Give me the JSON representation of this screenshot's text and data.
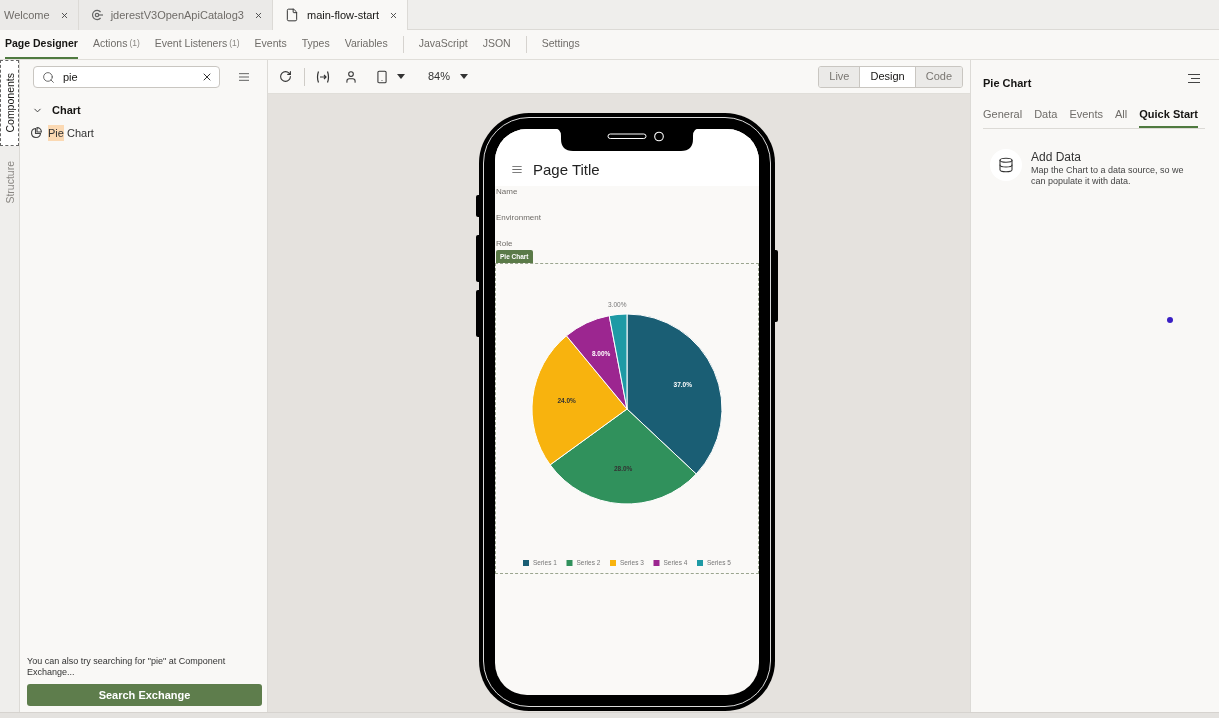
{
  "editor_tabs": [
    {
      "label": "Welcome",
      "kind": "plain",
      "selected": false
    },
    {
      "label": "jderestV3OpenApiCatalog3",
      "kind": "service",
      "selected": false
    },
    {
      "label": "main-flow-start",
      "kind": "page",
      "selected": true
    }
  ],
  "designer_tab_groups": [
    {
      "tabs": [
        {
          "label": "Page Designer",
          "selected": true
        },
        {
          "label": "Actions",
          "count": "(1)",
          "selected": false
        },
        {
          "label": "Event Listeners",
          "count": "(1)",
          "selected": false
        },
        {
          "label": "Events",
          "selected": false
        },
        {
          "label": "Types",
          "selected": false
        },
        {
          "label": "Variables",
          "selected": false
        }
      ]
    },
    {
      "tabs": [
        {
          "label": "JavaScript",
          "selected": false
        },
        {
          "label": "JSON",
          "selected": false
        }
      ]
    },
    {
      "tabs": [
        {
          "label": "Settings",
          "selected": false
        }
      ]
    }
  ],
  "side_tabs": [
    {
      "label": "Components",
      "selected": true
    },
    {
      "label": "Structure",
      "selected": false
    }
  ],
  "components_panel": {
    "search": {
      "value": "pie"
    },
    "groups": [
      {
        "label": "Chart",
        "expanded": true,
        "children": [
          {
            "label_parts": [
              {
                "text": "Pie",
                "highlighted": true
              },
              {
                "text": "Chart",
                "highlighted": false
              }
            ]
          }
        ]
      }
    ],
    "hint": "You can also try searching for \"pie\" at Component Exchange...",
    "button": "Search Exchange"
  },
  "toolbar": {
    "zoom": "84%",
    "modes": [
      {
        "label": "Live",
        "selected": false
      },
      {
        "label": "Design",
        "selected": true
      },
      {
        "label": "Code",
        "selected": false
      }
    ]
  },
  "phone_preview": {
    "page_title": "Page Title",
    "fields": [
      "Name",
      "Environment",
      "Role"
    ],
    "selected_component": "Pie Chart",
    "chart_data": {
      "type": "pie",
      "categories": [
        "Series 1",
        "Series 2",
        "Series 3",
        "Series 4",
        "Series 5"
      ],
      "values": [
        37,
        28,
        24,
        8,
        3
      ],
      "colors": [
        "#1a5e74",
        "#30915c",
        "#f8b30e",
        "#9c2690",
        "#1e9aa5"
      ],
      "value_labels": [
        "37.0%",
        "28.0%",
        "24.0%",
        "8.00%",
        "3.00%"
      ],
      "legend": "bottom"
    }
  },
  "properties_panel": {
    "title": "Pie Chart",
    "tabs": [
      {
        "label": "General",
        "selected": false
      },
      {
        "label": "Data",
        "selected": false
      },
      {
        "label": "Events",
        "selected": false
      },
      {
        "label": "All",
        "selected": false
      },
      {
        "label": "Quick Start",
        "selected": true
      }
    ],
    "quick_start": [
      {
        "title": "Add Data",
        "description": "Map the Chart to a data source, so we can populate it with data."
      }
    ]
  }
}
